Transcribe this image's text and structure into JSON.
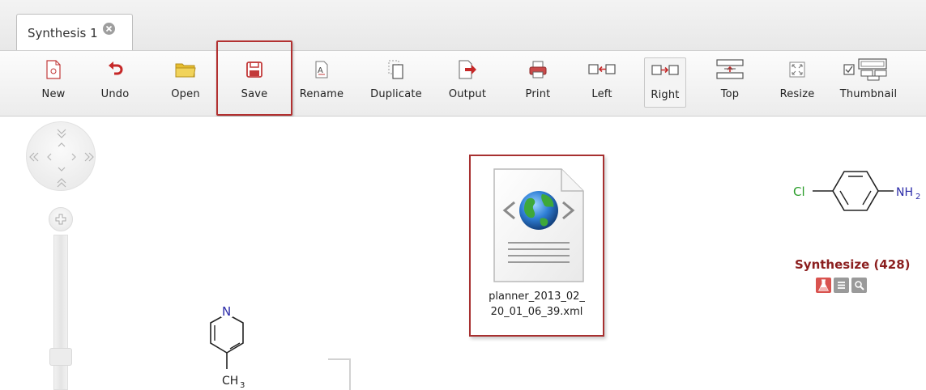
{
  "tab": {
    "label": "Synthesis 1"
  },
  "toolbar": {
    "new": "New",
    "undo": "Undo",
    "open": "Open",
    "save": "Save",
    "rename": "Rename",
    "duplicate": "Duplicate",
    "output": "Output",
    "print": "Print",
    "left": "Left",
    "right": "Right",
    "top": "Top",
    "resize": "Resize",
    "thumbnail": "Thumbnail"
  },
  "file": {
    "line1": "planner_2013_02_",
    "line2": "20_01_06_39.xml"
  },
  "molecule_right": {
    "left_atom": "Cl",
    "right_atom": "NH",
    "right_sub": "2"
  },
  "molecule_left": {
    "ring_atom": "N",
    "sub_group": "CH",
    "sub_index": "3"
  },
  "synthesize": {
    "label": "Synthesize (428)"
  },
  "colors": {
    "highlight": "#b23030",
    "synth_text": "#8b1e1e",
    "chem_green": "#2a9d2a",
    "chem_blue": "#2b2ba8"
  },
  "icons": [
    "new-icon",
    "undo-icon",
    "open-folder-icon",
    "save-floppy-icon",
    "rename-icon",
    "duplicate-icon",
    "output-icon",
    "print-icon",
    "left-arrange-icon",
    "right-arrange-icon",
    "top-arrange-icon",
    "resize-icon",
    "thumbnail-icon",
    "flask-icon",
    "list-icon",
    "magnifier-icon"
  ]
}
